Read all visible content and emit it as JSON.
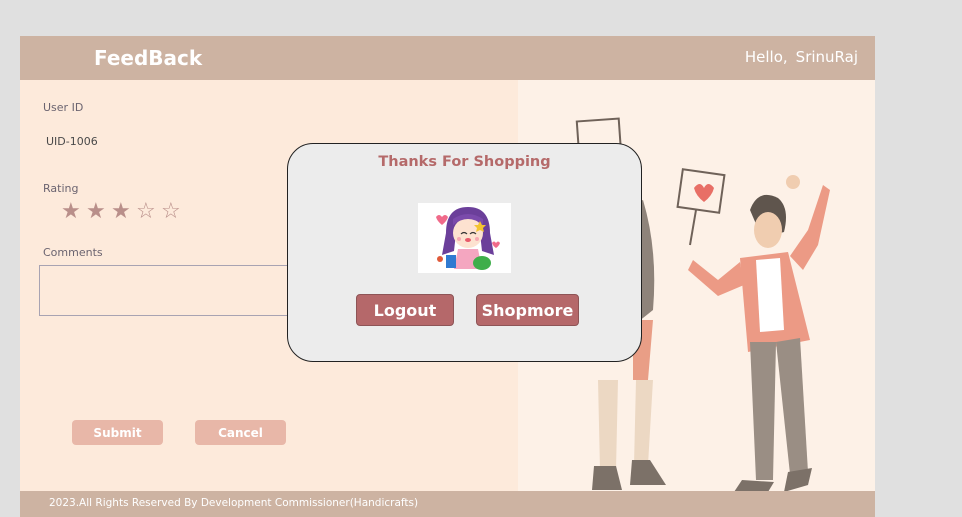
{
  "header": {
    "title": "FeedBack",
    "greeting": "Hello,",
    "username": "SrinuRaj"
  },
  "form": {
    "user_id_label": "User ID",
    "user_id_value": "UID-1006",
    "rating_label": "Rating",
    "rating_value": 3,
    "rating_max": 5,
    "stars": [
      "★",
      "★",
      "★",
      "☆",
      "☆"
    ],
    "comments_label": "Comments",
    "comments_value": "",
    "submit_label": "Submit",
    "cancel_label": "Cancel"
  },
  "footer": {
    "text": "2023.All Rights Reserved By Development Commissioner(Handicrafts)"
  },
  "modal": {
    "title": "Thanks For Shopping",
    "image_icon": "girl-with-shopping-bags-illustration",
    "logout_label": "Logout",
    "shopmore_label": "Shopmore"
  },
  "colors": {
    "header_bg": "#cdb3a2",
    "form_bg": "#fdeadb",
    "accent_button": "#b5686a",
    "light_button": "#e8b7a8",
    "modal_title": "#b56a6a",
    "star": "#b98f8a"
  }
}
